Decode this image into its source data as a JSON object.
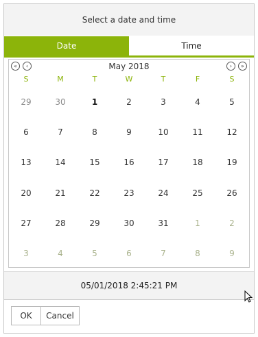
{
  "dialog": {
    "title": "Select a date and time"
  },
  "tabs": [
    {
      "label": "Date",
      "active": true
    },
    {
      "label": "Time",
      "active": false
    }
  ],
  "calendar": {
    "month_title": "May 2018",
    "weekdays": [
      "S",
      "M",
      "T",
      "W",
      "T",
      "F",
      "S"
    ],
    "weeks": [
      [
        "29",
        "30",
        "1",
        "2",
        "3",
        "4",
        "5"
      ],
      [
        "6",
        "7",
        "8",
        "9",
        "10",
        "11",
        "12"
      ],
      [
        "13",
        "14",
        "15",
        "16",
        "17",
        "18",
        "19"
      ],
      [
        "20",
        "21",
        "22",
        "23",
        "24",
        "25",
        "26"
      ],
      [
        "27",
        "28",
        "29",
        "30",
        "31",
        "1",
        "2"
      ],
      [
        "3",
        "4",
        "5",
        "6",
        "7",
        "8",
        "9"
      ]
    ],
    "selected_day": "1",
    "icons": {
      "prev_year": "double-chevron-left-icon",
      "prev_month": "chevron-left-icon",
      "next_month": "chevron-right-icon",
      "next_year": "double-chevron-right-icon"
    }
  },
  "selected_value": "05/01/2018 2:45:21 PM",
  "buttons": {
    "ok": "OK",
    "cancel": "Cancel"
  },
  "colors": {
    "accent": "#8cb40a",
    "header_bg": "#f3f3f3",
    "border": "#c8c8c8",
    "other_month": "#a9b28c"
  }
}
